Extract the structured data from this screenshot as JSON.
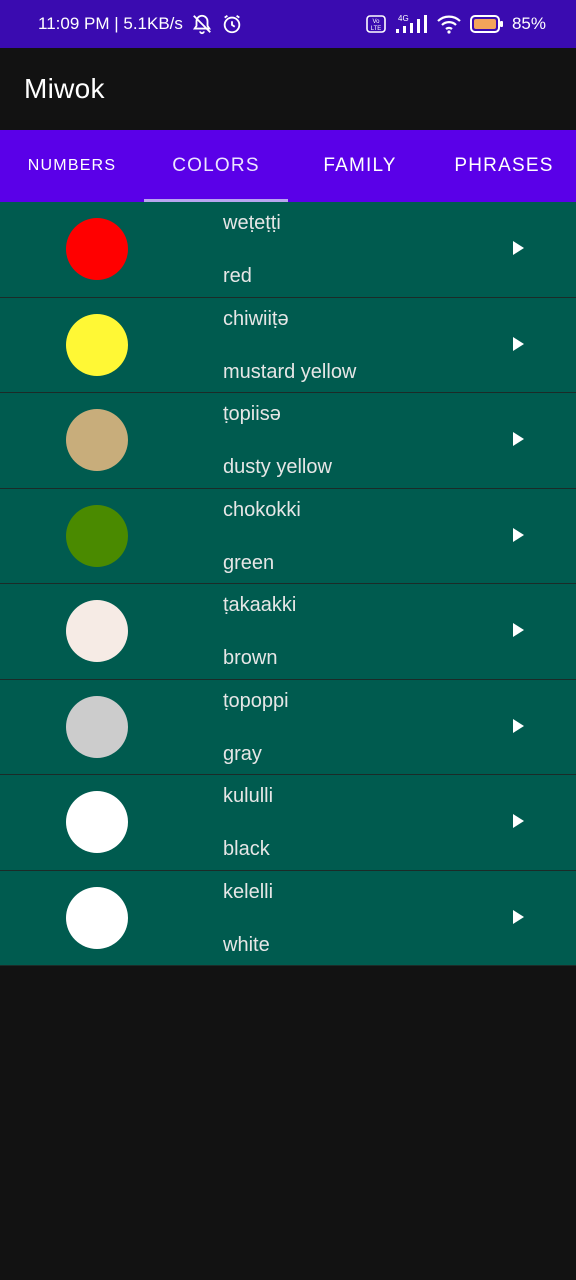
{
  "status_bar": {
    "time_speed": "11:09 PM | 5.1KB/s",
    "network_label": "4G",
    "volte_label": "Vo LTE",
    "battery": "85%"
  },
  "app_bar": {
    "title": "Miwok"
  },
  "tabs": [
    {
      "label": "NUMBERS",
      "active": false
    },
    {
      "label": "COLORS",
      "active": true
    },
    {
      "label": "FAMILY",
      "active": false
    },
    {
      "label": "PHRASES",
      "active": false
    }
  ],
  "words": [
    {
      "miwok": "weṭeṭṭi",
      "english": "red",
      "color": "#ff0000"
    },
    {
      "miwok": "chiwiiṭə",
      "english": "mustard yellow",
      "color": "#fff835"
    },
    {
      "miwok": "ṭopiisə",
      "english": "dusty yellow",
      "color": "#c8ad7b"
    },
    {
      "miwok": "chokokki",
      "english": "green",
      "color": "#4a8a00"
    },
    {
      "miwok": "ṭakaakki",
      "english": "brown",
      "color": "#f6ebe5"
    },
    {
      "miwok": "ṭopoppi",
      "english": "gray",
      "color": "#cccccc"
    },
    {
      "miwok": "kululli",
      "english": "black",
      "color": "#ffffff"
    },
    {
      "miwok": "kelelli",
      "english": "white",
      "color": "#ffffff"
    }
  ],
  "colors": {
    "status_bar": "#3a0bb0",
    "tab_bar": "#5a00e8",
    "row_bg": "#005b4f",
    "page_bg": "#121212"
  },
  "icons": {
    "play": "play-icon",
    "mute": "bell-off-icon",
    "alarm": "alarm-icon",
    "signal": "signal-icon",
    "wifi": "wifi-icon",
    "battery": "battery-icon"
  }
}
